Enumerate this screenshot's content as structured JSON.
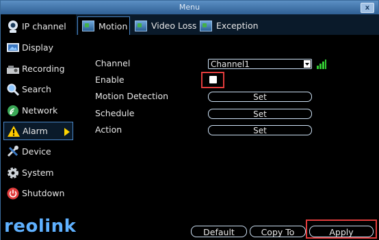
{
  "window": {
    "title": "Menu",
    "close_label": "x"
  },
  "sidebar": {
    "items": [
      {
        "label": "IP channel",
        "icon": "camera-icon"
      },
      {
        "label": "Display",
        "icon": "monitor-icon"
      },
      {
        "label": "Recording",
        "icon": "recorder-icon"
      },
      {
        "label": "Search",
        "icon": "magnifier-icon"
      },
      {
        "label": "Network",
        "icon": "network-icon"
      },
      {
        "label": "Alarm",
        "icon": "warning-icon",
        "active": true
      },
      {
        "label": "Device",
        "icon": "tools-icon"
      },
      {
        "label": "System",
        "icon": "gear-icon"
      },
      {
        "label": "Shutdown",
        "icon": "power-icon"
      }
    ],
    "logo": "reolink"
  },
  "tabs": [
    {
      "label": "Motion",
      "active": true
    },
    {
      "label": "Video Loss"
    },
    {
      "label": "Exception"
    }
  ],
  "form": {
    "channel_label": "Channel",
    "channel_value": "Channel1",
    "enable_label": "Enable",
    "enable_checked": false,
    "motion_detection_label": "Motion Detection",
    "schedule_label": "Schedule",
    "action_label": "Action",
    "set_label": "Set"
  },
  "buttons": {
    "default": "Default",
    "copy_to": "Copy To",
    "apply": "Apply"
  },
  "colors": {
    "accent": "#4a86c6",
    "highlight": "#e23c3c",
    "logo": "#5fb1ff",
    "signal": "#33cc33"
  }
}
